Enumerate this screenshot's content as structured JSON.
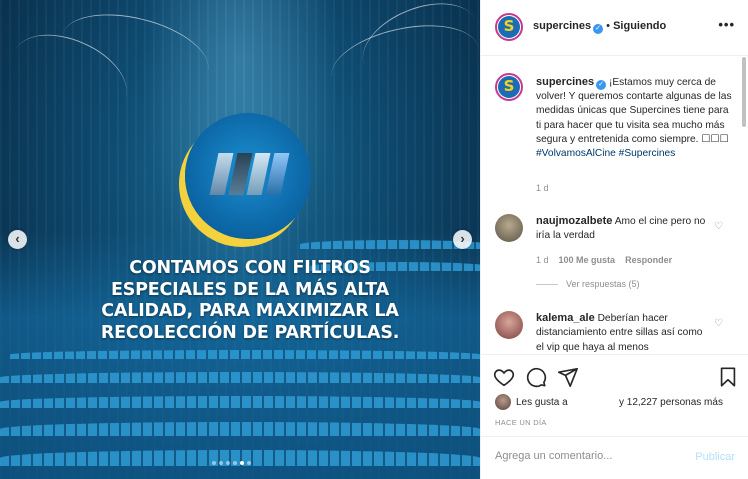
{
  "media": {
    "headline_lines": [
      "CONTAMOS CON FILTROS",
      "ESPECIALES DE LA MÁS ALTA",
      "CALIDAD, PARA MAXIMIZAR LA",
      "RECOLECCIÓN DE PARTÍCULAS."
    ],
    "prev_glyph": "‹",
    "next_glyph": "›",
    "carousel": {
      "count": 6,
      "active_index": 4
    }
  },
  "header": {
    "username": "supercines",
    "avatar_letter": "S",
    "verified_glyph": "✓",
    "separator": "•",
    "follow_label": "Siguiendo",
    "more_label": "•••"
  },
  "caption": {
    "username": "supercines",
    "text": "¡Estamos muy cerca de volver! Y queremos contarte algunas de las medidas únicas que Supercines tiene para ti para hacer que tu visita sea mucho más segura y entretenida como siempre. ☐☐☐",
    "hashtags": "#VolvamosAlCine #Supercines",
    "age": "1 d"
  },
  "comments": [
    {
      "username": "naujmozalbete",
      "text": "Amo el cine pero no iría la verdad",
      "age": "1 d",
      "likes": "100 Me gusta",
      "reply_label": "Responder",
      "view_replies": "Ver respuestas (5)"
    },
    {
      "username": "kalema_ale",
      "text": "Deberían hacer distanciamiento entre sillas así como el vip que haya al menos"
    }
  ],
  "actions": {
    "liked_by": "Les gusta a",
    "others": "y 12,227 personas más",
    "timestamp": "HACE UN DÍA"
  },
  "comment_box": {
    "placeholder": "Agrega un comentario...",
    "publish_label": "Publicar"
  },
  "colors": {
    "link": "#00376b",
    "verified": "#3897f0",
    "muted": "#8e8e8e",
    "publish_disabled": "#b2dffc",
    "brand_blue": "#1b6cb5",
    "brand_yellow": "#f4d21e"
  }
}
